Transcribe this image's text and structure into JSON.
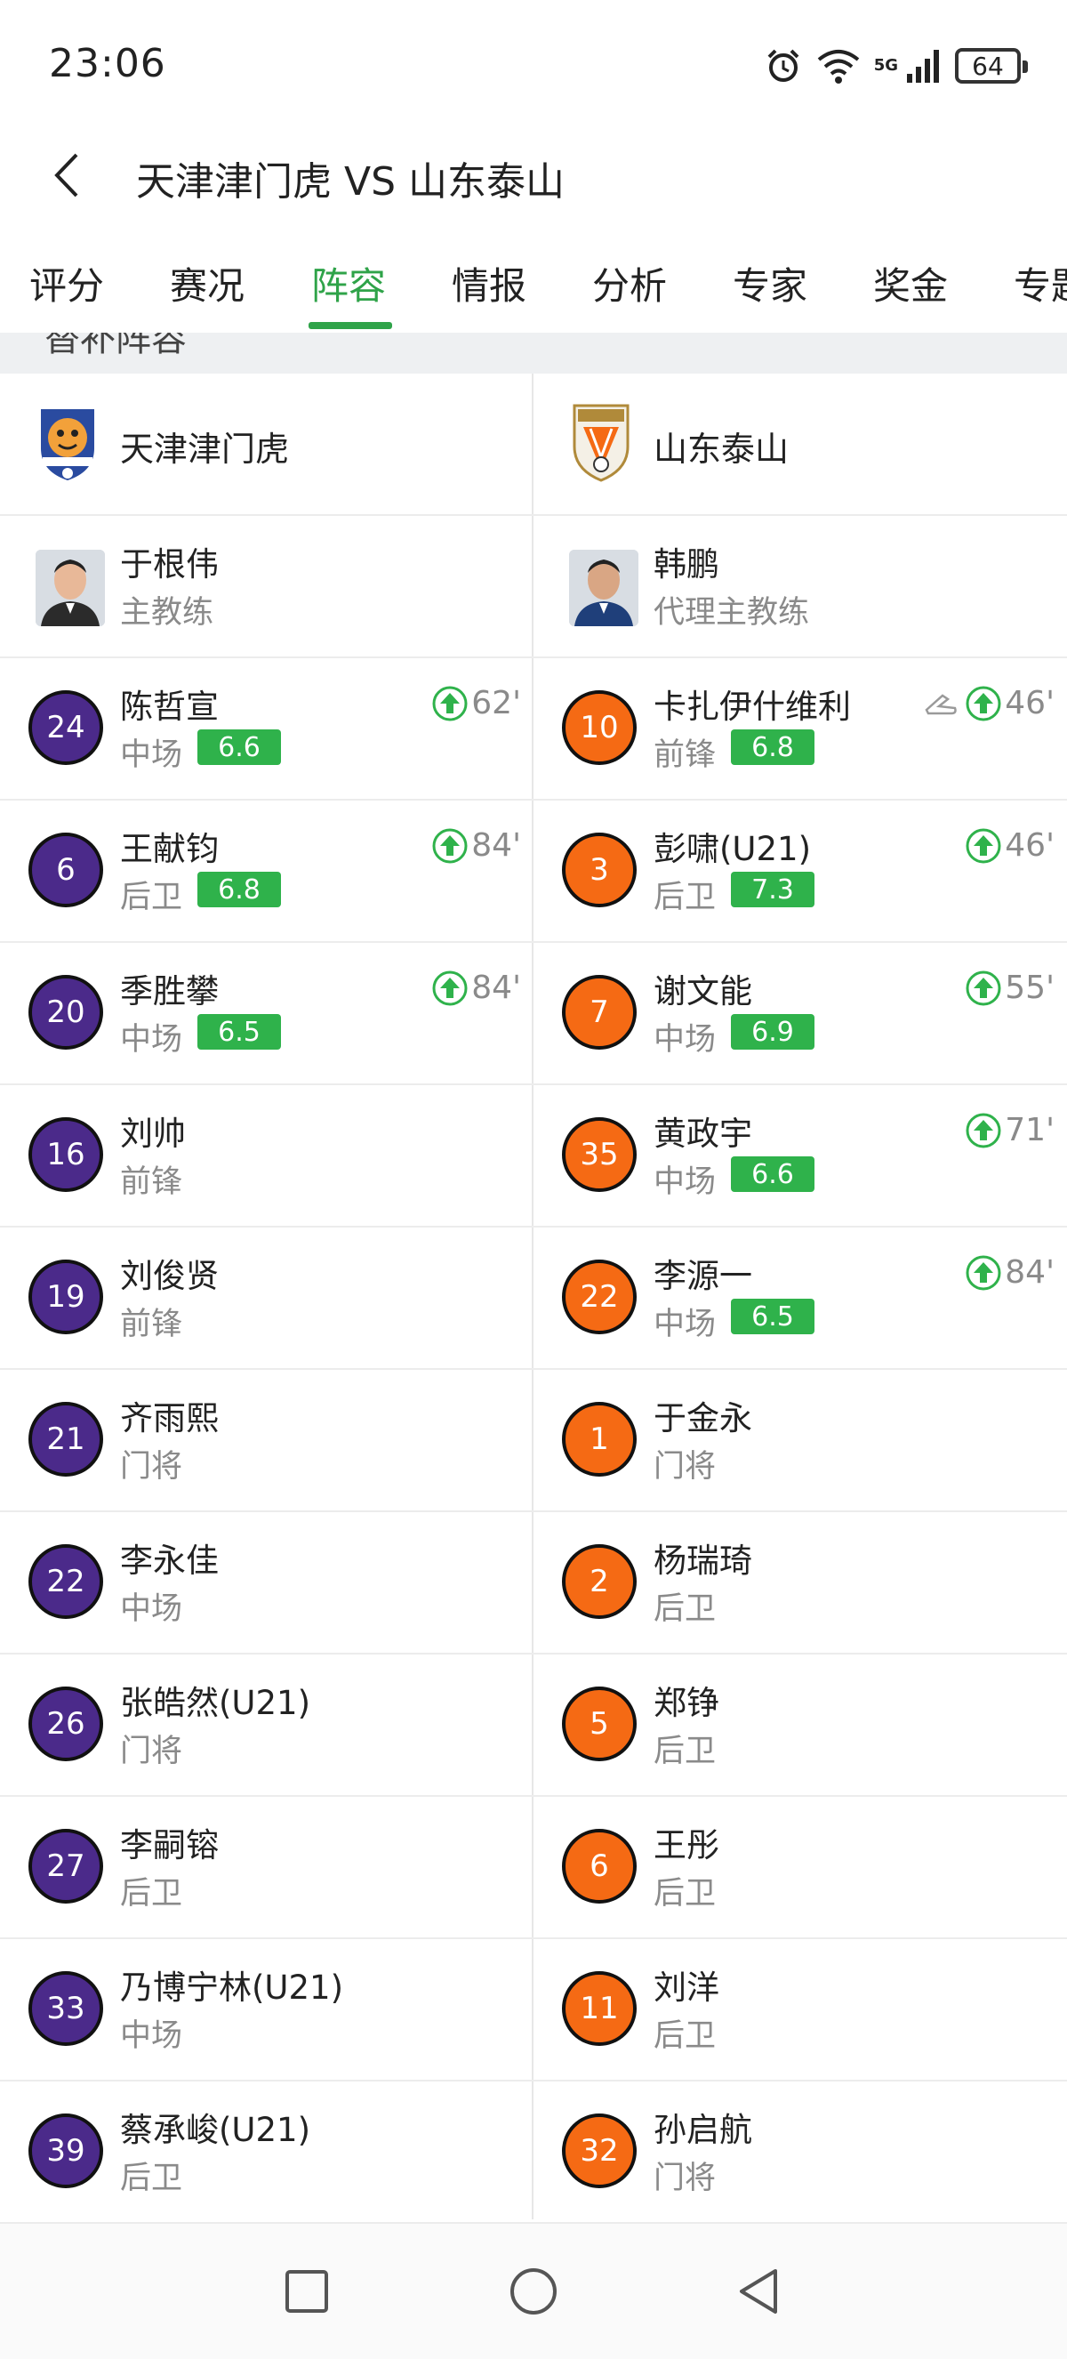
{
  "status": {
    "time": "23:06",
    "network": "5G",
    "battery": "64"
  },
  "header": {
    "title": "天津津门虎 VS 山东泰山"
  },
  "tabs": [
    "评分",
    "赛况",
    "阵容",
    "情报",
    "分析",
    "专家",
    "奖金",
    "专题"
  ],
  "active_tab": "阵容",
  "section_title": "替补阵容",
  "home": {
    "team": "天津津门虎",
    "coach": {
      "name": "于根伟",
      "role": "主教练"
    },
    "players": [
      {
        "number": "24",
        "name": "陈哲宣",
        "position": "中场",
        "rating": "6.6",
        "sub_minute": "62'"
      },
      {
        "number": "6",
        "name": "王献钧",
        "position": "后卫",
        "rating": "6.8",
        "sub_minute": "84'"
      },
      {
        "number": "20",
        "name": "季胜攀",
        "position": "中场",
        "rating": "6.5",
        "sub_minute": "84'"
      },
      {
        "number": "16",
        "name": "刘帅",
        "position": "前锋"
      },
      {
        "number": "19",
        "name": "刘俊贤",
        "position": "前锋"
      },
      {
        "number": "21",
        "name": "齐雨熙",
        "position": "门将"
      },
      {
        "number": "22",
        "name": "李永佳",
        "position": "中场"
      },
      {
        "number": "26",
        "name": "张皓然(U21)",
        "position": "门将"
      },
      {
        "number": "27",
        "name": "李嗣镕",
        "position": "后卫"
      },
      {
        "number": "33",
        "name": "乃博宁林(U21)",
        "position": "中场"
      },
      {
        "number": "39",
        "name": "蔡承峻(U21)",
        "position": "后卫"
      }
    ]
  },
  "away": {
    "team": "山东泰山",
    "coach": {
      "name": "韩鹏",
      "role": "代理主教练"
    },
    "players": [
      {
        "number": "10",
        "name": "卡扎伊什维利",
        "position": "前锋",
        "rating": "6.8",
        "sub_minute": "46'",
        "boot": true
      },
      {
        "number": "3",
        "name": "彭啸(U21)",
        "position": "后卫",
        "rating": "7.3",
        "sub_minute": "46'"
      },
      {
        "number": "7",
        "name": "谢文能",
        "position": "中场",
        "rating": "6.9",
        "sub_minute": "55'"
      },
      {
        "number": "35",
        "name": "黄政宇",
        "position": "中场",
        "rating": "6.6",
        "sub_minute": "71'"
      },
      {
        "number": "22",
        "name": "李源一",
        "position": "中场",
        "rating": "6.5",
        "sub_minute": "84'"
      },
      {
        "number": "1",
        "name": "于金永",
        "position": "门将"
      },
      {
        "number": "2",
        "name": "杨瑞琦",
        "position": "后卫"
      },
      {
        "number": "5",
        "name": "郑铮",
        "position": "后卫"
      },
      {
        "number": "6",
        "name": "王彤",
        "position": "后卫"
      },
      {
        "number": "11",
        "name": "刘洋",
        "position": "后卫"
      },
      {
        "number": "32",
        "name": "孙启航",
        "position": "门将"
      }
    ]
  },
  "colors": {
    "accent": "#2fa349",
    "home_badge": "#4b2a8a",
    "away_badge": "#f56a14",
    "rating_bg": "#2fb24b"
  },
  "icons": [
    "alarm-icon",
    "wifi-icon",
    "signal-icon",
    "battery-icon",
    "back-icon",
    "sub-in-icon",
    "boot-icon",
    "recent-apps-icon",
    "home-icon",
    "back-nav-icon"
  ]
}
